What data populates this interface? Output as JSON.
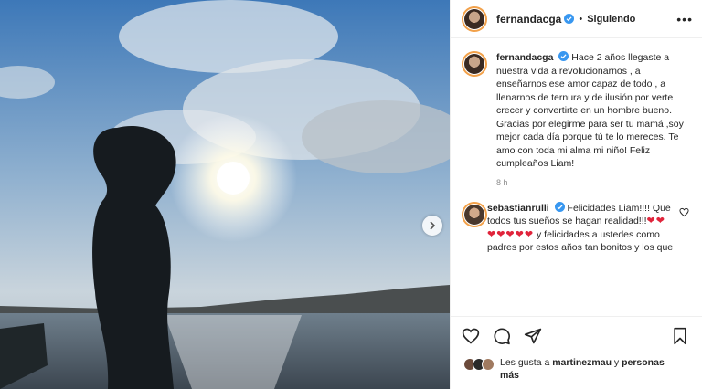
{
  "post": {
    "image_alt": "Silhouette of a curly-haired child facing the sun over the water",
    "next_icon": "chevron-right-icon"
  },
  "header": {
    "username": "fernandacga",
    "separator": "•",
    "follow_status": "Siguiendo",
    "more_icon": "more-options-icon"
  },
  "caption": {
    "username": "fernandacga",
    "text": "Hace 2 años llegaste a nuestra vida a revolucionarnos , a enseñarnos ese amor capaz de todo , a llenarnos de ternura y de ilusión por verte crecer y convertirte en un hombre bueno. Gracias por elegirme para ser tu mamá ,soy mejor cada día porque tú te lo mereces. Te amo con toda mi alma mi niño! Feliz cumpleaños Liam!",
    "time": "8 h"
  },
  "comment": {
    "username": "sebastianrulli",
    "text_before": "Felicidades Liam!!!! Que todos tus sueños se hagan realidad!!!",
    "hearts": "❤❤❤❤❤❤❤",
    "text_after": "y felicidades a ustedes como padres por estos años tan bonitos y los que"
  },
  "likes": {
    "prefix": "Les gusta a",
    "user": "martinezmau",
    "conj": "y",
    "others": "personas más"
  },
  "colors": {
    "story_ring": "#f2a14a",
    "verified": "#3897f0",
    "heart": "#e0243b"
  }
}
